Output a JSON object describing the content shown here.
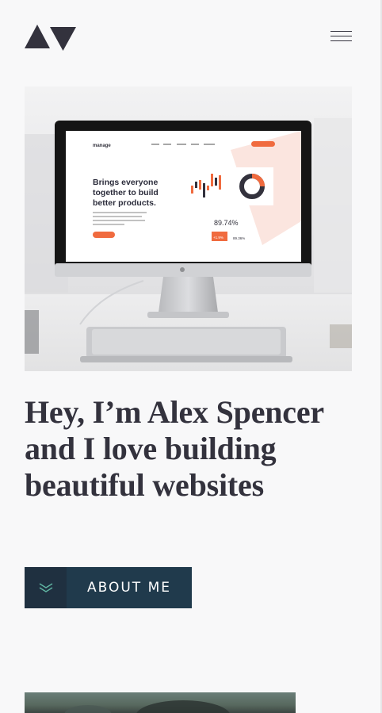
{
  "header": {
    "logo_icon": "av-logo-icon",
    "menu_icon": "hamburger-menu-icon"
  },
  "hero": {
    "image_icon": "hero-monitor-image",
    "screen": {
      "brand": "manage",
      "headline_line1": "Brings everyone",
      "headline_line2": "together to build",
      "headline_line3": "better products.",
      "stat_value": "89.74%",
      "stat_badge": "+1.9%",
      "stat_small": "89.36%"
    },
    "title": "Hey, I’m Alex Spencer and I love building beautiful websites",
    "cta_label": "ABOUT ME",
    "cta_icon": "double-chevron-down-icon"
  },
  "colors": {
    "text_dark": "#33323d",
    "button_dark": "#203a4c",
    "button_icon_box": "#1f3040",
    "accent_teal": "#5fb4a2",
    "accent_orange": "#f06b3f"
  }
}
